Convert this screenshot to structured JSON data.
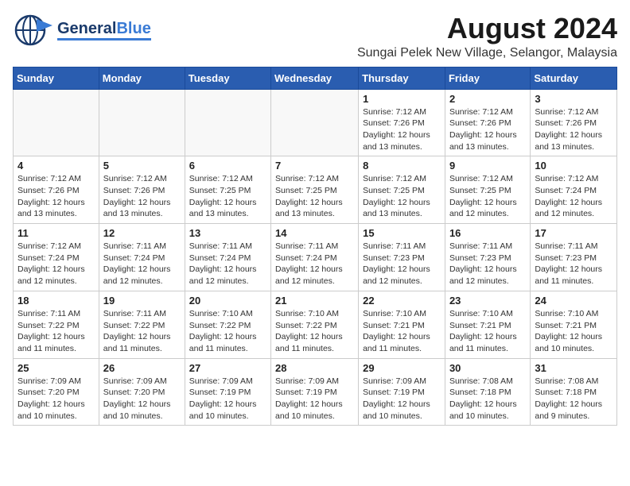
{
  "header": {
    "logo_general": "General",
    "logo_blue": "Blue",
    "title": "August 2024",
    "subtitle": "Sungai Pelek New Village, Selangor, Malaysia"
  },
  "calendar": {
    "days_of_week": [
      "Sunday",
      "Monday",
      "Tuesday",
      "Wednesday",
      "Thursday",
      "Friday",
      "Saturday"
    ],
    "weeks": [
      {
        "days": [
          {
            "num": "",
            "info": ""
          },
          {
            "num": "",
            "info": ""
          },
          {
            "num": "",
            "info": ""
          },
          {
            "num": "",
            "info": ""
          },
          {
            "num": "1",
            "info": "Sunrise: 7:12 AM\nSunset: 7:26 PM\nDaylight: 12 hours\nand 13 minutes."
          },
          {
            "num": "2",
            "info": "Sunrise: 7:12 AM\nSunset: 7:26 PM\nDaylight: 12 hours\nand 13 minutes."
          },
          {
            "num": "3",
            "info": "Sunrise: 7:12 AM\nSunset: 7:26 PM\nDaylight: 12 hours\nand 13 minutes."
          }
        ]
      },
      {
        "days": [
          {
            "num": "4",
            "info": "Sunrise: 7:12 AM\nSunset: 7:26 PM\nDaylight: 12 hours\nand 13 minutes."
          },
          {
            "num": "5",
            "info": "Sunrise: 7:12 AM\nSunset: 7:26 PM\nDaylight: 12 hours\nand 13 minutes."
          },
          {
            "num": "6",
            "info": "Sunrise: 7:12 AM\nSunset: 7:25 PM\nDaylight: 12 hours\nand 13 minutes."
          },
          {
            "num": "7",
            "info": "Sunrise: 7:12 AM\nSunset: 7:25 PM\nDaylight: 12 hours\nand 13 minutes."
          },
          {
            "num": "8",
            "info": "Sunrise: 7:12 AM\nSunset: 7:25 PM\nDaylight: 12 hours\nand 13 minutes."
          },
          {
            "num": "9",
            "info": "Sunrise: 7:12 AM\nSunset: 7:25 PM\nDaylight: 12 hours\nand 12 minutes."
          },
          {
            "num": "10",
            "info": "Sunrise: 7:12 AM\nSunset: 7:24 PM\nDaylight: 12 hours\nand 12 minutes."
          }
        ]
      },
      {
        "days": [
          {
            "num": "11",
            "info": "Sunrise: 7:12 AM\nSunset: 7:24 PM\nDaylight: 12 hours\nand 12 minutes."
          },
          {
            "num": "12",
            "info": "Sunrise: 7:11 AM\nSunset: 7:24 PM\nDaylight: 12 hours\nand 12 minutes."
          },
          {
            "num": "13",
            "info": "Sunrise: 7:11 AM\nSunset: 7:24 PM\nDaylight: 12 hours\nand 12 minutes."
          },
          {
            "num": "14",
            "info": "Sunrise: 7:11 AM\nSunset: 7:24 PM\nDaylight: 12 hours\nand 12 minutes."
          },
          {
            "num": "15",
            "info": "Sunrise: 7:11 AM\nSunset: 7:23 PM\nDaylight: 12 hours\nand 12 minutes."
          },
          {
            "num": "16",
            "info": "Sunrise: 7:11 AM\nSunset: 7:23 PM\nDaylight: 12 hours\nand 12 minutes."
          },
          {
            "num": "17",
            "info": "Sunrise: 7:11 AM\nSunset: 7:23 PM\nDaylight: 12 hours\nand 11 minutes."
          }
        ]
      },
      {
        "days": [
          {
            "num": "18",
            "info": "Sunrise: 7:11 AM\nSunset: 7:22 PM\nDaylight: 12 hours\nand 11 minutes."
          },
          {
            "num": "19",
            "info": "Sunrise: 7:11 AM\nSunset: 7:22 PM\nDaylight: 12 hours\nand 11 minutes."
          },
          {
            "num": "20",
            "info": "Sunrise: 7:10 AM\nSunset: 7:22 PM\nDaylight: 12 hours\nand 11 minutes."
          },
          {
            "num": "21",
            "info": "Sunrise: 7:10 AM\nSunset: 7:22 PM\nDaylight: 12 hours\nand 11 minutes."
          },
          {
            "num": "22",
            "info": "Sunrise: 7:10 AM\nSunset: 7:21 PM\nDaylight: 12 hours\nand 11 minutes."
          },
          {
            "num": "23",
            "info": "Sunrise: 7:10 AM\nSunset: 7:21 PM\nDaylight: 12 hours\nand 11 minutes."
          },
          {
            "num": "24",
            "info": "Sunrise: 7:10 AM\nSunset: 7:21 PM\nDaylight: 12 hours\nand 10 minutes."
          }
        ]
      },
      {
        "days": [
          {
            "num": "25",
            "info": "Sunrise: 7:09 AM\nSunset: 7:20 PM\nDaylight: 12 hours\nand 10 minutes."
          },
          {
            "num": "26",
            "info": "Sunrise: 7:09 AM\nSunset: 7:20 PM\nDaylight: 12 hours\nand 10 minutes."
          },
          {
            "num": "27",
            "info": "Sunrise: 7:09 AM\nSunset: 7:19 PM\nDaylight: 12 hours\nand 10 minutes."
          },
          {
            "num": "28",
            "info": "Sunrise: 7:09 AM\nSunset: 7:19 PM\nDaylight: 12 hours\nand 10 minutes."
          },
          {
            "num": "29",
            "info": "Sunrise: 7:09 AM\nSunset: 7:19 PM\nDaylight: 12 hours\nand 10 minutes."
          },
          {
            "num": "30",
            "info": "Sunrise: 7:08 AM\nSunset: 7:18 PM\nDaylight: 12 hours\nand 10 minutes."
          },
          {
            "num": "31",
            "info": "Sunrise: 7:08 AM\nSunset: 7:18 PM\nDaylight: 12 hours\nand 9 minutes."
          }
        ]
      }
    ]
  }
}
